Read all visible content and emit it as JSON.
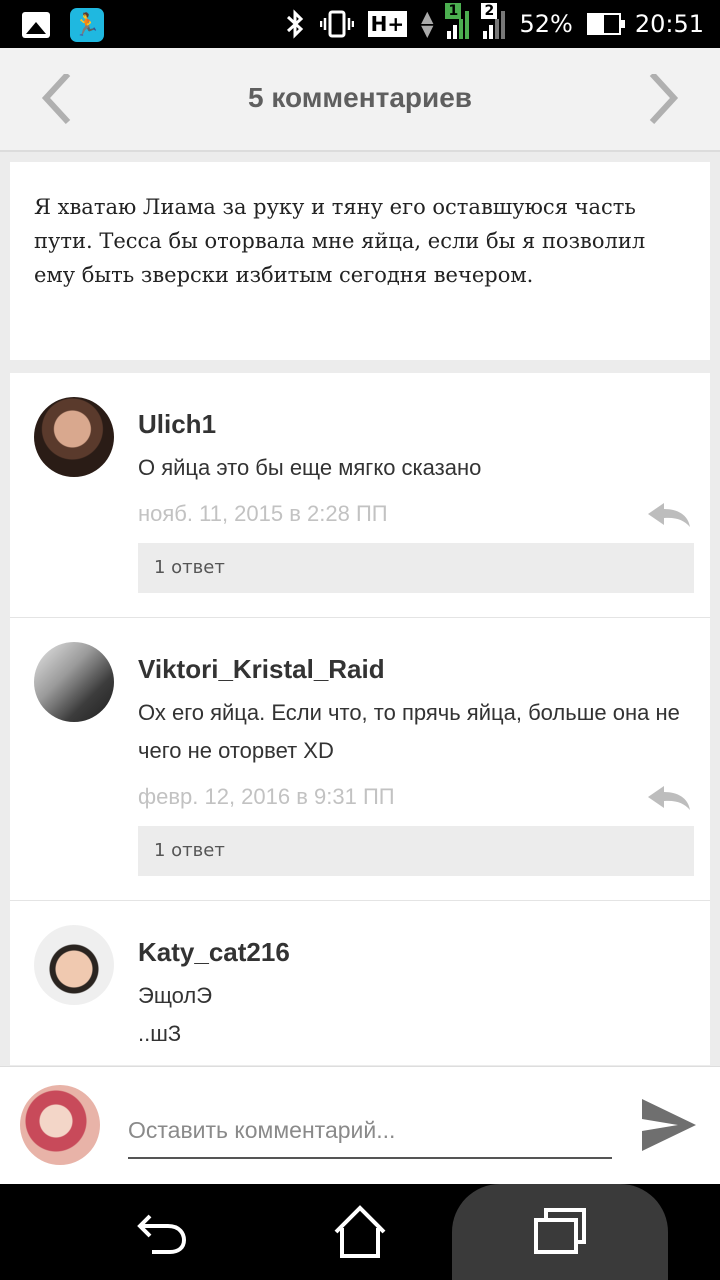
{
  "status_bar": {
    "network_type": "H+",
    "sim1": "1",
    "sim2": "2",
    "battery": "52%",
    "time": "20:51",
    "icons": [
      "photo-icon",
      "app-icon",
      "bluetooth-icon",
      "vibrate-icon",
      "data-arrows-icon",
      "signal-icon",
      "battery-icon"
    ]
  },
  "header": {
    "title": "5 комментариев",
    "prev_icon": "chevron-left-icon",
    "next_icon": "chevron-right-icon"
  },
  "excerpt": {
    "text": "Я хватаю Лиама за руку и тяну его оставшуюся часть пути. Тесса бы оторвала мне яйца, если бы я позволил ему быть зверски избитым сегодня вечером."
  },
  "comments": [
    {
      "user": "Ulich1",
      "text": "О яйца это бы еще мягко сказано",
      "date": "нояб. 11, 2015 в 2:28 ПП",
      "replies": "1 ответ"
    },
    {
      "user": "Viktori_Kristal_Raid",
      "text": "Ох его яйца. Если что, то прячь яйца, больше она не чего не оторвет XD",
      "date": "февр. 12, 2016 в 9:31 ПП",
      "replies": "1 ответ"
    },
    {
      "user": "Katy_cat216",
      "text_line1": "ЭщолЭ",
      "text_line2": "..шЗ"
    }
  ],
  "composer": {
    "placeholder": "Оставить комментарий..."
  },
  "nav": {
    "icons": [
      "back-icon",
      "home-icon",
      "recents-icon"
    ]
  },
  "colors": {
    "header_bg": "#f2f2f2",
    "page_bg": "#ececec",
    "status_bar_bg": "#000000",
    "reply_bg": "#ececec",
    "date_text": "#c2c2c2",
    "app_icon": "#1fb8e0"
  }
}
